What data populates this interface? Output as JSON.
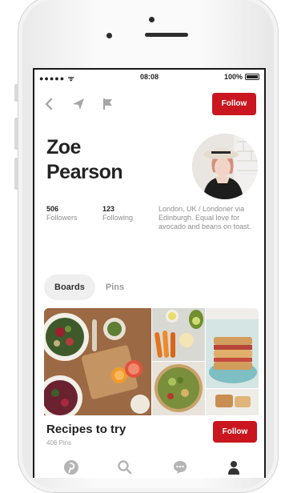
{
  "status_bar": {
    "carrier": "●●●●● ᯤ",
    "time": "08:08",
    "battery": "100%"
  },
  "nav": {
    "back_icon": "chevron-left-icon",
    "send_icon": "send-icon",
    "report_icon": "flag-icon",
    "follow_label": "Follow"
  },
  "profile": {
    "first_name": "Zoe",
    "last_name": "Pearson",
    "followers_count": "506",
    "followers_label": "Followers",
    "following_count": "123",
    "following_label": "Following",
    "bio": "London, UK / Londoner via Edinburgh. Equal love for avocado and beans on toast."
  },
  "tabs": [
    {
      "label": "Boards",
      "active": true
    },
    {
      "label": "Pins",
      "active": false
    }
  ],
  "board": {
    "title": "Recipes to try",
    "pin_count": "406 Pins",
    "follow_label": "Follow"
  },
  "tab_bar": [
    "pinterest-logo-icon",
    "search-icon",
    "chat-icon",
    "profile-icon"
  ],
  "colors": {
    "accent": "#c9161f",
    "text": "#232323",
    "muted": "#8e8e8e"
  }
}
